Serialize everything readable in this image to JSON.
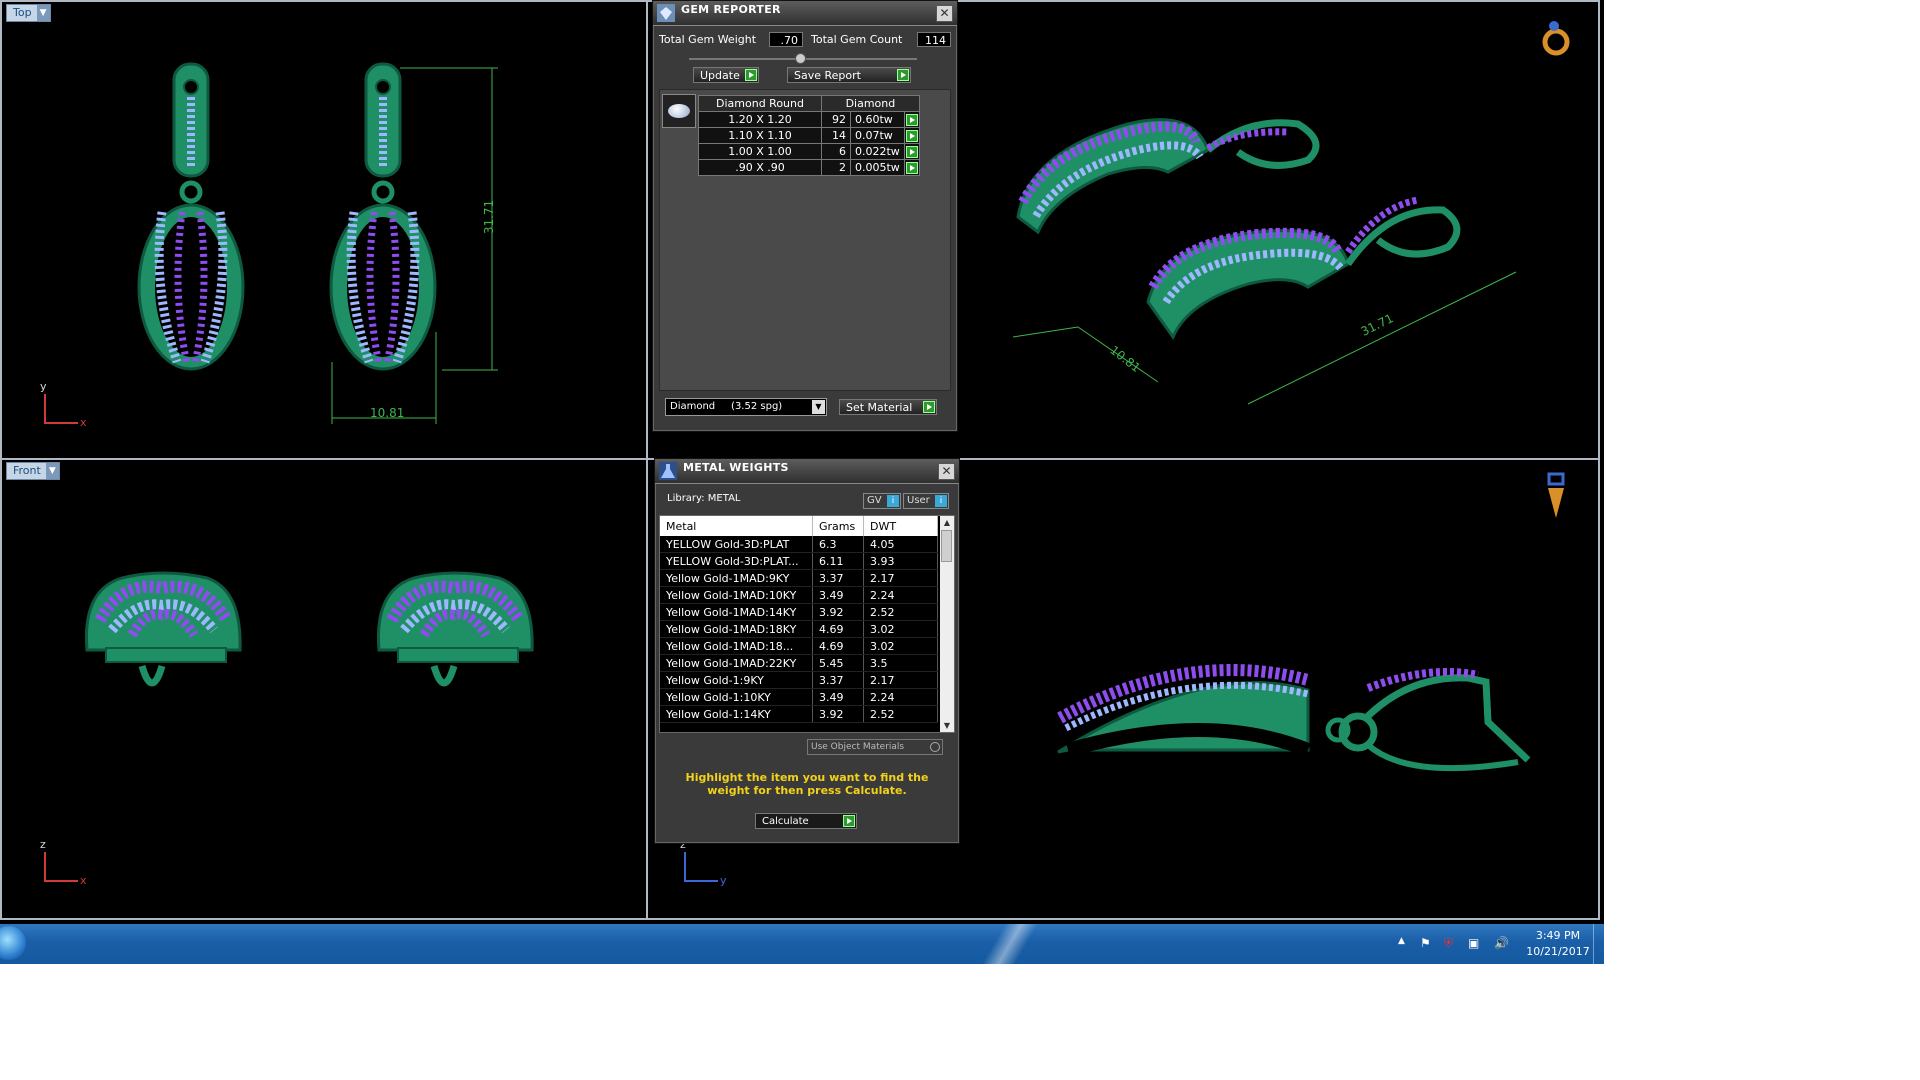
{
  "viewports": {
    "top_left": {
      "label": "Top",
      "axis_v": "y",
      "axis_h": "x",
      "dim_height": "31.71",
      "dim_width": "10.81"
    },
    "top_right": {
      "dim_long": "31.71",
      "dim_short": "10.81"
    },
    "bottom_left": {
      "label": "Front",
      "axis_v": "z",
      "axis_h": "x"
    },
    "bottom_right": {
      "axis_v": "z",
      "axis_h": "y"
    }
  },
  "gem_reporter": {
    "title": "GEM REPORTER",
    "total_weight_label": "Total Gem Weight",
    "total_weight_value": ".70",
    "total_count_label": "Total Gem Count",
    "total_count_value": "114",
    "update_label": "Update",
    "save_report_label": "Save Report",
    "table_headers": [
      "Diamond Round",
      "Diamond"
    ],
    "rows": [
      {
        "size": "1.20 X 1.20",
        "count": "92",
        "weight": "0.60tw"
      },
      {
        "size": "1.10 X 1.10",
        "count": "14",
        "weight": "0.07tw"
      },
      {
        "size": "1.00 X 1.00",
        "count": "6",
        "weight": "0.022tw"
      },
      {
        "size": ".90 X .90",
        "count": "2",
        "weight": "0.005tw"
      }
    ],
    "material_select": "Diamond     (3.52 spg)",
    "set_material_label": "Set Material"
  },
  "metal_weights": {
    "title": "METAL WEIGHTS",
    "library_label": "Library: METAL",
    "gv_label": "GV",
    "user_label": "User",
    "headers": [
      "Metal",
      "Grams",
      "DWT"
    ],
    "rows": [
      {
        "metal": "YELLOW Gold-3D:PLAT",
        "grams": "6.3",
        "dwt": "4.05"
      },
      {
        "metal": "YELLOW Gold-3D:PLAT...",
        "grams": "6.11",
        "dwt": "3.93"
      },
      {
        "metal": "Yellow Gold-1MAD:9KY",
        "grams": "3.37",
        "dwt": "2.17"
      },
      {
        "metal": "Yellow Gold-1MAD:10KY",
        "grams": "3.49",
        "dwt": "2.24"
      },
      {
        "metal": "Yellow Gold-1MAD:14KY",
        "grams": "3.92",
        "dwt": "2.52"
      },
      {
        "metal": "Yellow Gold-1MAD:18KY",
        "grams": "4.69",
        "dwt": "3.02"
      },
      {
        "metal": "Yellow Gold-1MAD:18...",
        "grams": "4.69",
        "dwt": "3.02"
      },
      {
        "metal": "Yellow Gold-1MAD:22KY",
        "grams": "5.45",
        "dwt": "3.5"
      },
      {
        "metal": "Yellow Gold-1:9KY",
        "grams": "3.37",
        "dwt": "2.17"
      },
      {
        "metal": "Yellow Gold-1:10KY",
        "grams": "3.49",
        "dwt": "2.24"
      },
      {
        "metal": "Yellow Gold-1:14KY",
        "grams": "3.92",
        "dwt": "2.52"
      }
    ],
    "use_object_materials": "Use Object Materials",
    "hint": "Highlight the item you want to find the weight for then press Calculate.",
    "calculate_label": "Calculate"
  },
  "taskbar": {
    "time": "3:49 PM",
    "date": "10/21/2017"
  },
  "colors": {
    "metal": "#1f8f66",
    "metal_dark": "#12664a",
    "gem": "#8f4df0",
    "gem_light": "#9db8ff",
    "dim": "#3fb64a",
    "hint": "#f2d21a"
  }
}
